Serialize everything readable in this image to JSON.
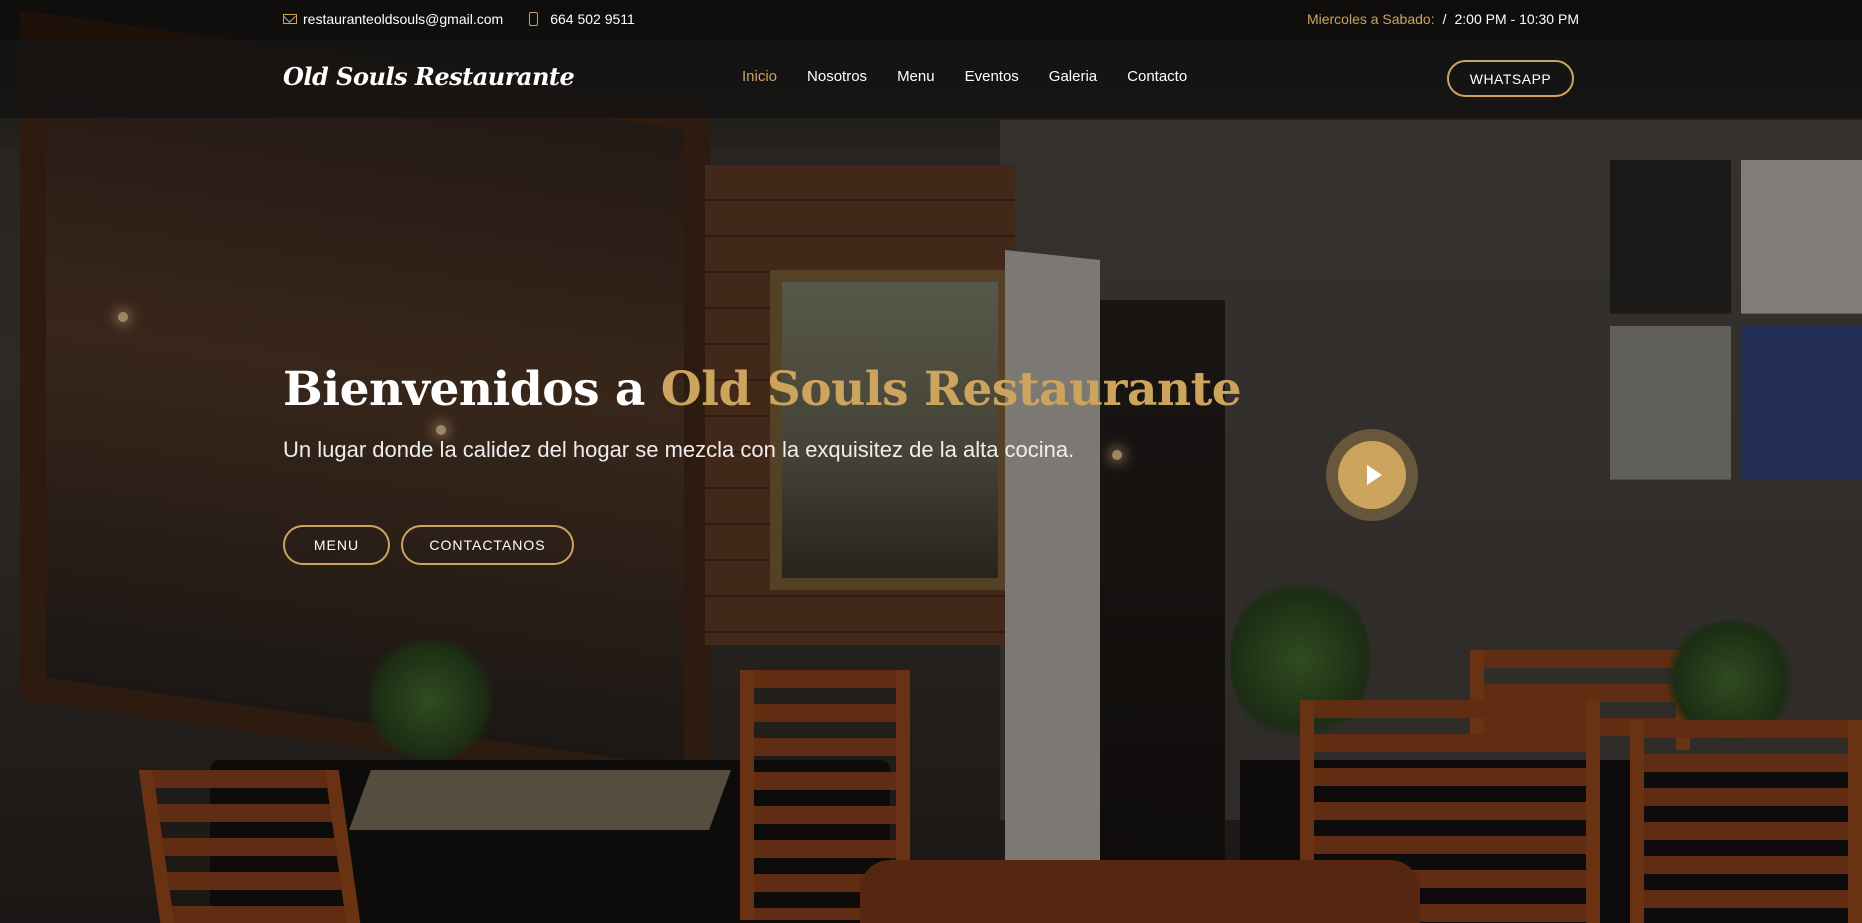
{
  "topbar": {
    "email": "restauranteoldsouls@gmail.com",
    "phone": "664 502 9511",
    "hours_days": "Miercoles a Sabado:",
    "hours_separator": "/",
    "hours_time": "2:00 PM - 10:30 PM"
  },
  "header": {
    "logo": "Old Souls Restaurante",
    "nav": [
      {
        "label": "Inicio",
        "active": true
      },
      {
        "label": "Nosotros"
      },
      {
        "label": "Menu"
      },
      {
        "label": "Eventos"
      },
      {
        "label": "Galeria"
      },
      {
        "label": "Contacto"
      }
    ],
    "whatsapp_label": "WHATSAPP"
  },
  "hero": {
    "title_prefix": "Bienvenidos a",
    "title_accent": "Old Souls Restaurante",
    "subtitle": "Un lugar donde la calidez del hogar se mezcla con la exquisitez de la alta cocina.",
    "menu_button": "MENU",
    "contact_button": "CONTACTANOS"
  },
  "icons": {
    "email": "envelope-icon",
    "phone": "phone-icon",
    "play": "play-icon"
  },
  "colors": {
    "accent": "#cda45e",
    "header_bg": "#121212"
  }
}
